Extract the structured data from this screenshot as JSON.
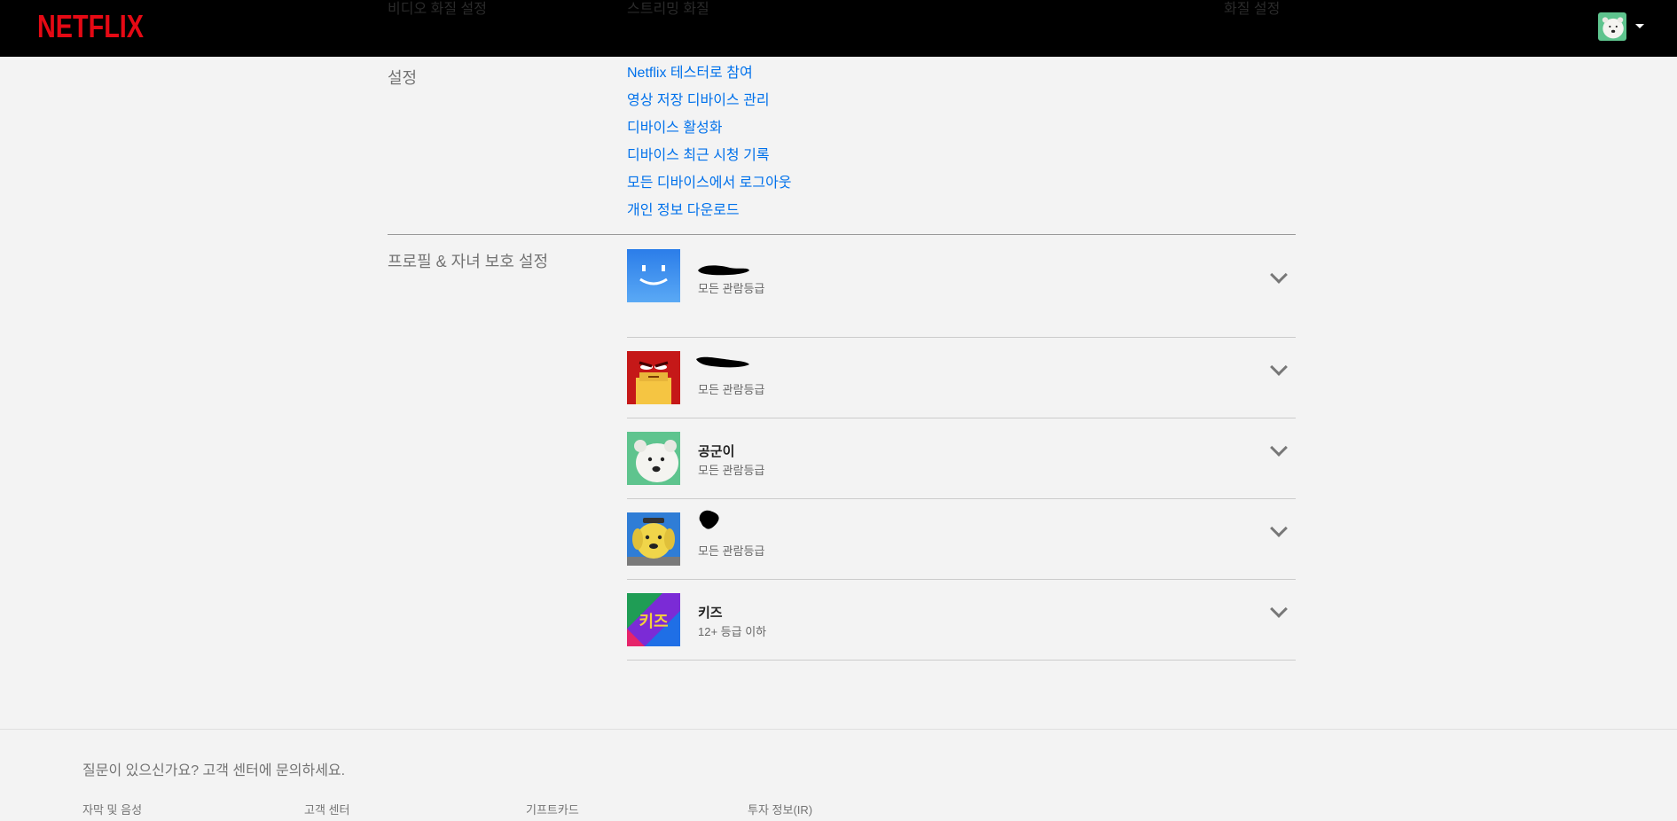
{
  "header": {
    "logo_text": "NETFLIX",
    "clipped_texts": [
      "비디오 화질 설정",
      "스트리밍 화질",
      "화질 설정"
    ],
    "profile_menu_icon": "caret-down-icon"
  },
  "settings": {
    "label": "설정",
    "links": [
      "Netflix 테스터로 참여",
      "영상 저장 디바이스 관리",
      "디바이스 활성화",
      "디바이스 최근 시청 기록",
      "모든 디바이스에서 로그아웃",
      "개인 정보 다운로드"
    ]
  },
  "profiles_section": {
    "label": "프로필 & 자녀 보호 설정",
    "profiles": [
      {
        "name": "",
        "rating": "모든 관람등급",
        "avatar": "blue-smiley"
      },
      {
        "name": "",
        "rating": "모든 관람등급",
        "avatar": "red-angry"
      },
      {
        "name": "공군이",
        "rating": "모든 관람등급",
        "avatar": "polar-bear"
      },
      {
        "name": "",
        "rating": "모든 관람등급",
        "avatar": "yellow-dog"
      },
      {
        "name": "키즈",
        "rating": "12+ 등급 이하",
        "avatar": "kids"
      }
    ]
  },
  "kids_avatar_text": "키즈",
  "footer": {
    "question": "질문이 있으신가요? 고객 센터에 문의하세요.",
    "links": [
      "자막 및 음성",
      "고객 센터",
      "기프트카드",
      "투자 정보(IR)"
    ]
  },
  "colors": {
    "brand_red": "#e50914",
    "link_blue": "#0071eb",
    "background": "#f3f3f3"
  }
}
